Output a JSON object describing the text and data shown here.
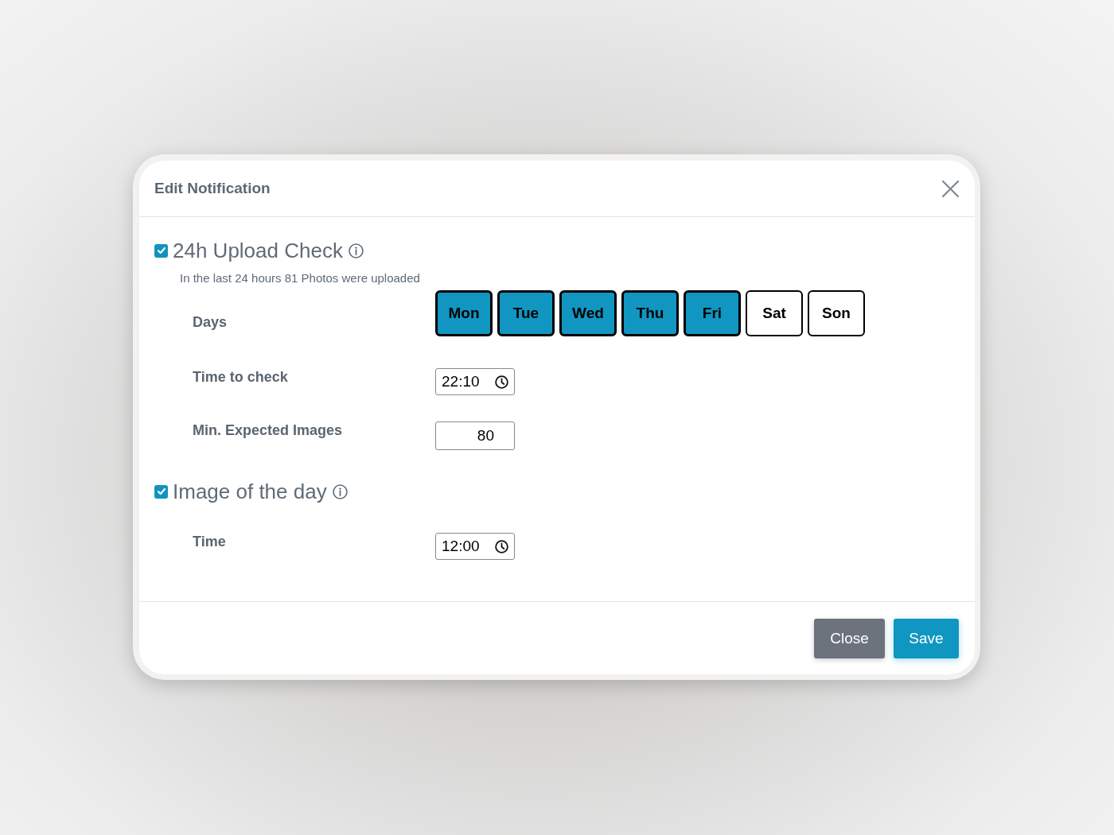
{
  "dialog": {
    "title": "Edit Notification"
  },
  "sections": [
    {
      "title": "24h Upload Check",
      "checked": true,
      "description": "In the last 24 hours 81 Photos were uploaded",
      "fields": [
        {
          "kind": "days",
          "label": "Days",
          "days": [
            {
              "label": "Mon",
              "selected": true
            },
            {
              "label": "Tue",
              "selected": true
            },
            {
              "label": "Wed",
              "selected": true
            },
            {
              "label": "Thu",
              "selected": true
            },
            {
              "label": "Fri",
              "selected": true
            },
            {
              "label": "Sat",
              "selected": false
            },
            {
              "label": "Son",
              "selected": false
            }
          ]
        },
        {
          "kind": "time",
          "label": "Time to check",
          "value": "22:10"
        },
        {
          "kind": "number",
          "label": "Min. Expected Images",
          "value": "80"
        }
      ]
    },
    {
      "title": "Image of the day",
      "checked": true,
      "fields": [
        {
          "kind": "time",
          "label": "Time",
          "value": "12:00"
        }
      ]
    }
  ],
  "buttons": [
    {
      "label": "Close",
      "kind": "secondary"
    },
    {
      "label": "Save",
      "kind": "primary"
    }
  ]
}
